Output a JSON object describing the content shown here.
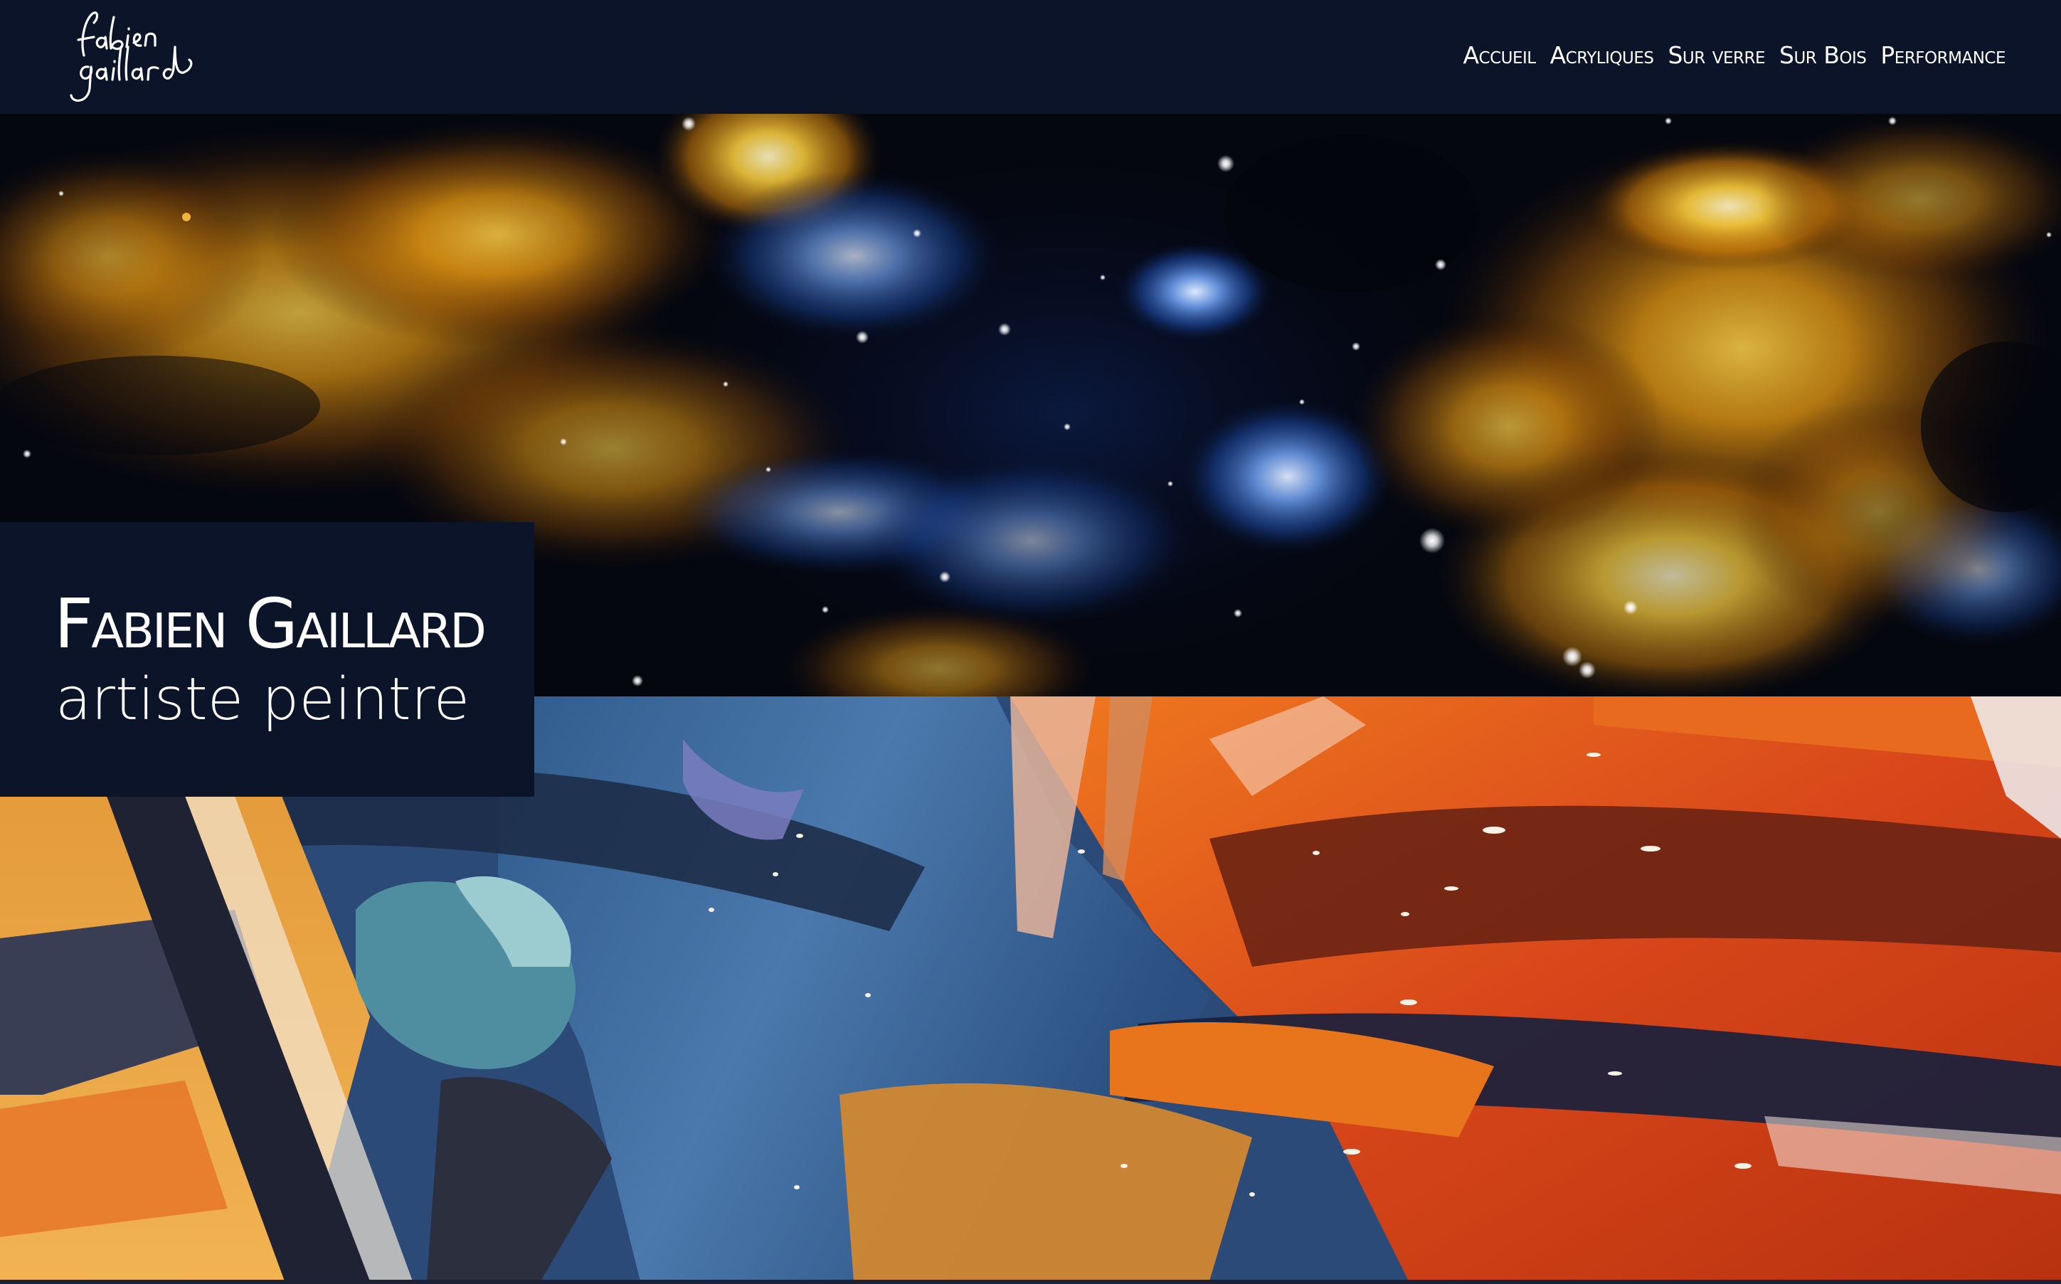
{
  "header": {
    "logo": {
      "line1": "fabien",
      "line2": "gaillard"
    },
    "nav": [
      {
        "label": "Accueil"
      },
      {
        "label": "Acryliques"
      },
      {
        "label": "Sur verre"
      },
      {
        "label": "Sur Bois"
      },
      {
        "label": "Performance"
      }
    ]
  },
  "hero": {
    "title": "Fabien Gaillard",
    "subtitle": "artiste peintre"
  },
  "colors": {
    "navy": "#0b1429",
    "gold": "#e8a317",
    "orange": "#d9480f",
    "blue": "#1e4fa8"
  }
}
